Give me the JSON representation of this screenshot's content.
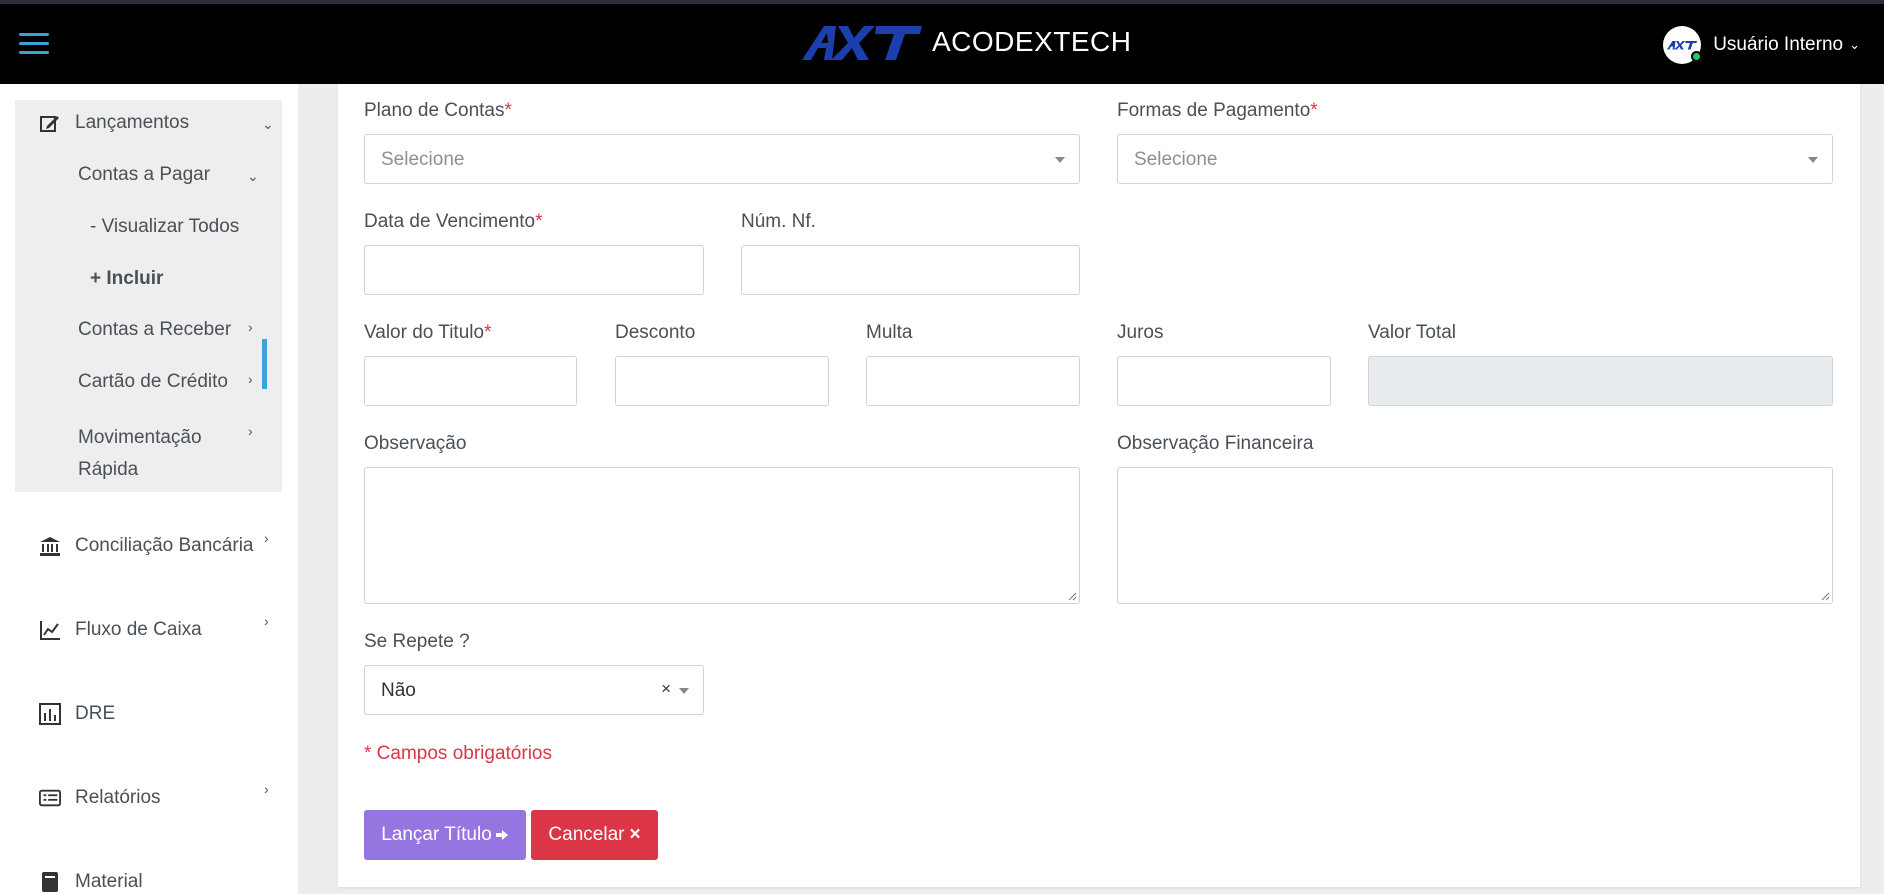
{
  "header": {
    "brand": "ACODEXTECH",
    "user": "Usuário Interno"
  },
  "sidebar": {
    "lancamentos": "Lançamentos",
    "contas_pagar": "Contas a Pagar",
    "visualizar_todos": "- Visualizar Todos",
    "incluir": "+ Incluir",
    "contas_receber": "Contas a Receber",
    "cartao_credito": "Cartão de Crédito",
    "movimentacao_1": "Movimentação",
    "movimentacao_2": "Rápida",
    "conciliacao": "Conciliação Bancária",
    "fluxo_caixa": "Fluxo de Caixa",
    "dre": "DRE",
    "relatorios": "Relatórios",
    "material": "Material"
  },
  "form": {
    "plano_contas": {
      "label": "Plano de Contas",
      "placeholder": "Selecione"
    },
    "formas_pagamento": {
      "label": "Formas de Pagamento",
      "placeholder": "Selecione"
    },
    "data_vencimento": {
      "label": "Data de Vencimento"
    },
    "num_nf": {
      "label": "Núm. Nf."
    },
    "valor_titulo": {
      "label": "Valor do Titulo"
    },
    "desconto": {
      "label": "Desconto"
    },
    "multa": {
      "label": "Multa"
    },
    "juros": {
      "label": "Juros"
    },
    "valor_total": {
      "label": "Valor Total"
    },
    "observacao": {
      "label": "Observação"
    },
    "observacao_financeira": {
      "label": "Observação Financeira"
    },
    "se_repete": {
      "label": "Se Repete ?",
      "value": "Não"
    },
    "required_mark": "*",
    "required_note": "* Campos obrigatórios",
    "submit_label": "Lançar Título",
    "cancel_label": "Cancelar"
  },
  "colors": {
    "accent": "#3aa4d8",
    "primary_button": "#9575e0",
    "danger_button": "#dc3545",
    "required": "#dc3545"
  }
}
